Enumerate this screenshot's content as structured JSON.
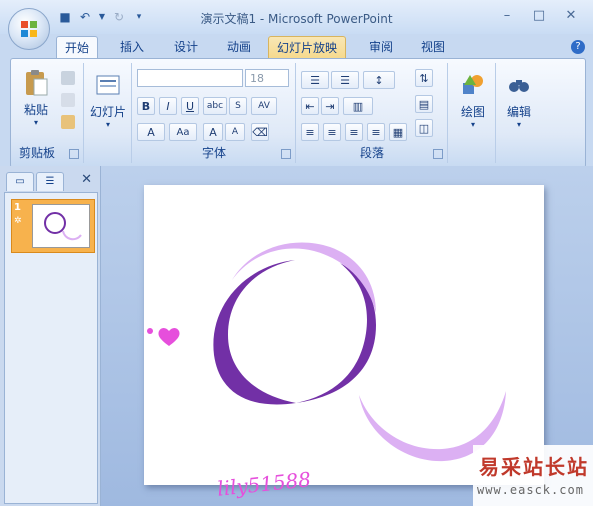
{
  "window": {
    "title": "演示文稿1 - Microsoft PowerPoint"
  },
  "ribbon_tabs": [
    "开始",
    "插入",
    "设计",
    "动画",
    "幻灯片放映",
    "审阅",
    "视图"
  ],
  "clipboard": {
    "paste": "粘贴",
    "group": "剪贴板"
  },
  "slides_group": {
    "label": "幻灯片"
  },
  "font": {
    "name_value": "",
    "size_value": "18",
    "group": "字体"
  },
  "paragraph": {
    "group": "段落"
  },
  "drawing": {
    "label": "绘图"
  },
  "editing": {
    "label": "编辑"
  },
  "thumbnail": {
    "number": "1"
  },
  "slide_content": {
    "signature": "lily51588"
  },
  "watermark": {
    "cn": "易采站长站",
    "url": "www.easck.com"
  },
  "colors": {
    "dark_ring": "#7230a6",
    "light_ring": "#dcb0f3",
    "heart": "#e64fdc",
    "accent": "#f7b24d"
  }
}
